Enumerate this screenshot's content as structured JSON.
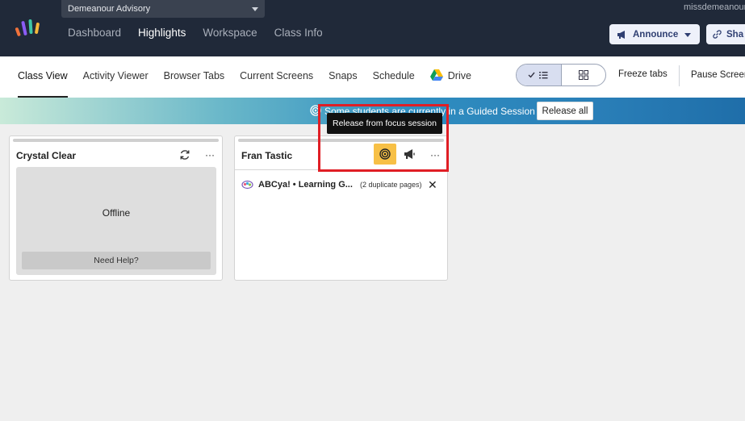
{
  "header": {
    "class_selector": "Demeanour Advisory",
    "user_email": "missdemeanour",
    "nav": [
      "Dashboard",
      "Highlights",
      "Workspace",
      "Class Info"
    ],
    "active_nav": "Highlights",
    "announce_label": "Announce",
    "share_label": "Sha"
  },
  "subnav": {
    "tabs": [
      "Class View",
      "Activity Viewer",
      "Browser Tabs",
      "Current Screens",
      "Snaps",
      "Schedule"
    ],
    "drive_label": "Drive",
    "freeze_label": "Freeze tabs",
    "pause_label": "Pause Screen"
  },
  "banner": {
    "text": "Some students are currently in a Guided Session",
    "release_all": "Release all"
  },
  "tooltip": "Release from focus session",
  "students": [
    {
      "name": "Crystal Clear",
      "status": "Offline",
      "help": "Need Help?",
      "more": "···"
    },
    {
      "name": "Fran Tastic",
      "more": "···",
      "tab_title": "ABCya! • Learning G...",
      "tab_dupes": "(2 duplicate pages)",
      "close": "✕"
    }
  ],
  "colors": {
    "topbar": "#202939",
    "focus_button": "#f7c046",
    "highlight": "#e01e25"
  }
}
